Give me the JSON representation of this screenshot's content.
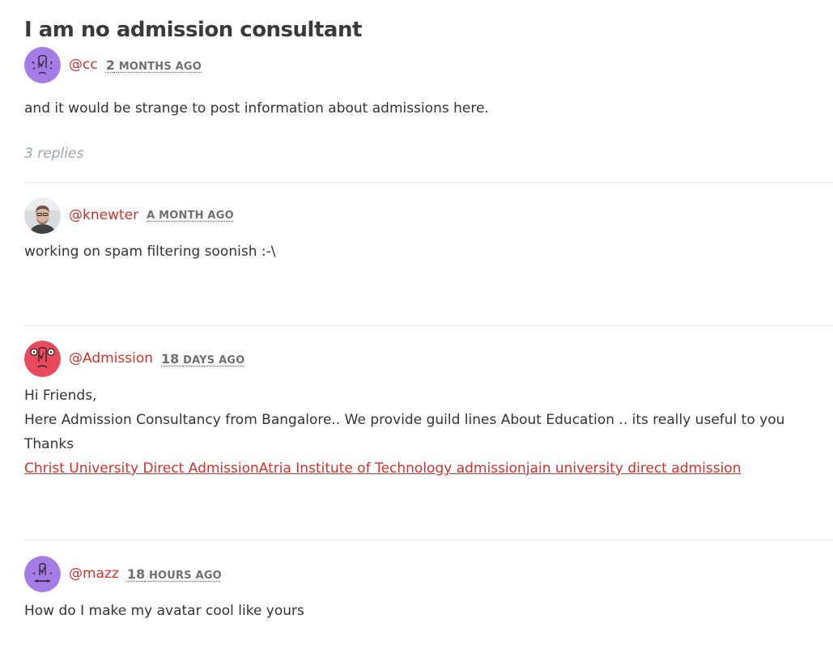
{
  "thread": {
    "title": "I am no admission consultant"
  },
  "op": {
    "username": "@cc",
    "time_num": "2",
    "time_unit": "MONTHS AGO",
    "avatar_icon": "doodle-face-avatar-icon",
    "avatar_color": "#a57ce6",
    "body": "and it would be strange to post information about admissions here.",
    "replies_label": "3 replies"
  },
  "replies": [
    {
      "username": "@knewter",
      "time_num": "",
      "time_unit": "A MONTH AGO",
      "avatar_icon": "user-photo-avatar",
      "body_lines": [
        "working on spam filtering soonish :-\\"
      ]
    },
    {
      "username": "@Admission",
      "time_num": "18",
      "time_unit": "DAYS AGO",
      "avatar_icon": "doodle-face-avatar-icon",
      "avatar_color": "#e9495c",
      "body_lines": [
        "Hi Friends,",
        "Here Admission Consultancy from Bangalore.. We provide guild lines About Education .. its really useful to you",
        "Thanks"
      ],
      "links": [
        "Christ University Direct Admission",
        "Atria Institute of Technology admission",
        "jain university direct admission"
      ]
    },
    {
      "username": "@mazz",
      "time_num": "18",
      "time_unit": "HOURS AGO",
      "avatar_icon": "doodle-face-avatar-icon",
      "avatar_color": "#a57ce6",
      "body_lines": [
        "How do I make my avatar cool like yours"
      ]
    }
  ],
  "colors": {
    "username": "#d0302b",
    "link": "#d0302b",
    "timestamp": "#6f6f6f",
    "replies_count": "#9aa3ad",
    "divider": "#e4e8ec"
  }
}
